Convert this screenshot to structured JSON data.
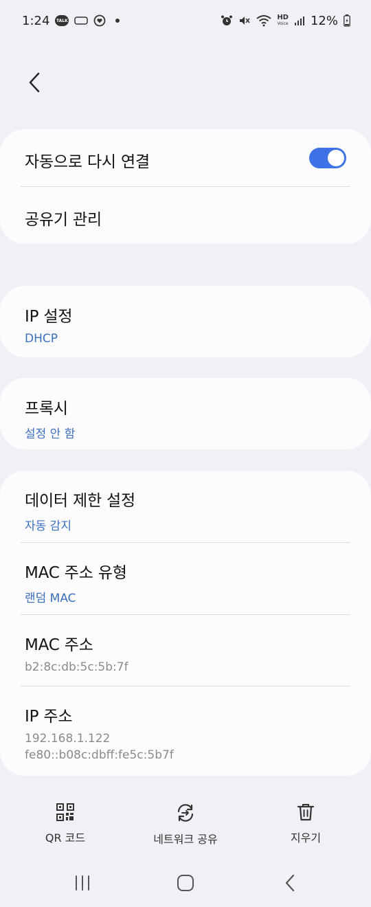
{
  "status_bar": {
    "time": "1:24",
    "battery": "12%",
    "talk_badge": "TALK",
    "hd_label": "HD"
  },
  "sections": {
    "auto_reconnect": {
      "title": "자동으로 다시 연결",
      "enabled": true
    },
    "router_manage": {
      "title": "공유기 관리"
    },
    "ip_settings": {
      "title": "IP 설정",
      "value": "DHCP"
    },
    "proxy": {
      "title": "프록시",
      "value": "설정 안 함"
    },
    "metered": {
      "title": "데이터 제한 설정",
      "value": "자동 감지"
    },
    "mac_type": {
      "title": "MAC 주소 유형",
      "value": "랜덤 MAC"
    },
    "mac_address": {
      "title": "MAC 주소",
      "value": "b2:8c:db:5c:5b:7f"
    },
    "ip_address": {
      "title": "IP 주소",
      "ipv4": "192.168.1.122",
      "ipv6": "fe80::b08c:dbff:fe5c:5b7f"
    }
  },
  "bottom_actions": {
    "qr": "QR 코드",
    "share": "네트워크 공유",
    "forget": "지우기"
  },
  "colors": {
    "accent": "#3e72e6",
    "sub_blue": "#3b6fbe",
    "background": "#f1f1f5",
    "card": "#fcfcfe"
  }
}
